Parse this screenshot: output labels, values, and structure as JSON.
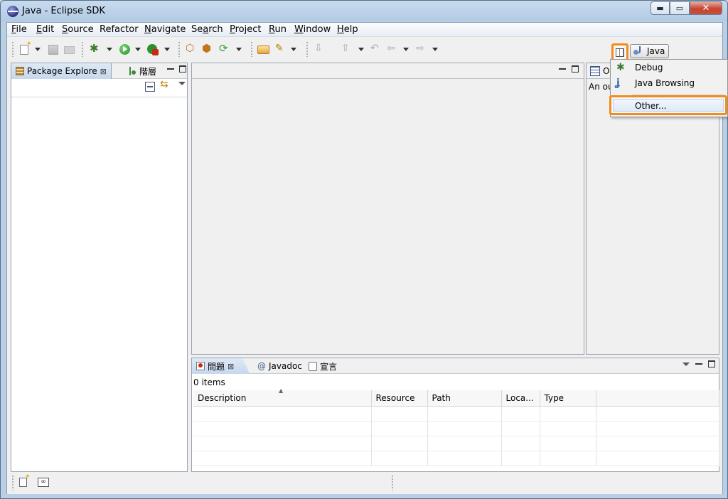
{
  "window": {
    "title": "Java - Eclipse SDK",
    "min_glyph": "▬",
    "max_glyph": "▭",
    "close_glyph": "✕"
  },
  "menubar": {
    "items": [
      {
        "label": "File",
        "mnemonic": "F",
        "rest": "ile"
      },
      {
        "label": "Edit",
        "mnemonic": "E",
        "rest": "dit"
      },
      {
        "label": "Source",
        "mnemonic": "S",
        "rest": "ource"
      },
      {
        "label": "Refactor",
        "mnemonic": "",
        "rest": "Refactor"
      },
      {
        "label": "Navigate",
        "mnemonic": "N",
        "rest": "avigate"
      },
      {
        "label": "Search",
        "mnemonic": "a",
        "pre": "Se",
        "rest": "rch"
      },
      {
        "label": "Project",
        "mnemonic": "P",
        "rest": "roject"
      },
      {
        "label": "Run",
        "mnemonic": "R",
        "rest": "un"
      },
      {
        "label": "Window",
        "mnemonic": "W",
        "rest": "indow"
      },
      {
        "label": "Help",
        "mnemonic": "H",
        "rest": "elp"
      }
    ]
  },
  "perspective": {
    "active_label": "Java"
  },
  "perspective_menu": {
    "items": [
      {
        "label": "Debug",
        "icon": "debug-bug-icon"
      },
      {
        "label": "Java Browsing",
        "icon": "java-browsing-icon"
      }
    ],
    "other_label": "Other..."
  },
  "left_view": {
    "tabs": [
      {
        "label": "Package Explore",
        "icon": "package-explorer-icon"
      },
      {
        "label": "階層",
        "icon": "hierarchy-icon"
      }
    ]
  },
  "right_view": {
    "tab_label": "Ou",
    "body_text": "An ou"
  },
  "bottom_view": {
    "tabs": [
      {
        "label": "問題",
        "icon": "problems-icon"
      },
      {
        "label": "Javadoc",
        "icon": "javadoc-icon",
        "prefix": "@"
      },
      {
        "label": "宣言",
        "icon": "declaration-icon"
      }
    ],
    "status": "0 items",
    "columns": [
      "Description",
      "Resource",
      "Path",
      "Loca...",
      "Type"
    ]
  },
  "icons": {
    "toolbar": [
      "new-icon",
      "save-icon",
      "print-icon",
      "debug-icon",
      "run-icon",
      "external-tools-icon",
      "new-java-project-icon",
      "new-package-icon",
      "new-class-icon",
      "open-type-icon",
      "search-icon",
      "next-annotation-icon",
      "prev-annotation-icon",
      "last-edit-icon",
      "back-icon",
      "forward-icon"
    ],
    "status": [
      "new-fast-view-icon",
      "memory-icon"
    ]
  },
  "colors": {
    "highlight_orange": "#f28c1b",
    "tab_active": "#c6d8ee"
  }
}
